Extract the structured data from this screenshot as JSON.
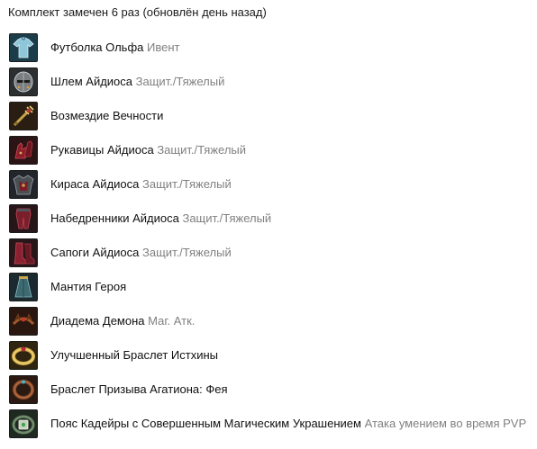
{
  "header": {
    "text": "Комплект замечен 6 раз (обновлён день назад)"
  },
  "items": [
    {
      "name": "Футболка Ольфа",
      "type": "Ивент",
      "icon": "shirt-icon"
    },
    {
      "name": "Шлем Айдиоса",
      "type": "Защит./Тяжелый",
      "icon": "helmet-icon"
    },
    {
      "name": "Возмездие Вечности",
      "type": "",
      "icon": "weapon-icon"
    },
    {
      "name": "Рукавицы Айдиоса",
      "type": "Защит./Тяжелый",
      "icon": "gloves-icon"
    },
    {
      "name": "Кираса Айдиоса",
      "type": "Защит./Тяжелый",
      "icon": "breastplate-icon"
    },
    {
      "name": "Набедренники Айдиоса",
      "type": "Защит./Тяжелый",
      "icon": "gaiters-icon"
    },
    {
      "name": "Сапоги Айдиоса",
      "type": "Защит./Тяжелый",
      "icon": "boots-icon"
    },
    {
      "name": "Мантия Героя",
      "type": "",
      "icon": "cloak-icon"
    },
    {
      "name": "Диадема Демона",
      "type": "Маг. Атк.",
      "icon": "circlet-icon"
    },
    {
      "name": "Улучшенный Браслет Истхины",
      "type": "",
      "icon": "bracelet-icon"
    },
    {
      "name": "Браслет Призыва Агатиона: Фея",
      "type": "",
      "icon": "agathion-bracelet-icon"
    },
    {
      "name": "Пояс Кадейры с Совершенным Магическим Украшением",
      "type": "Атака умением во время PVP",
      "icon": "belt-icon"
    }
  ]
}
